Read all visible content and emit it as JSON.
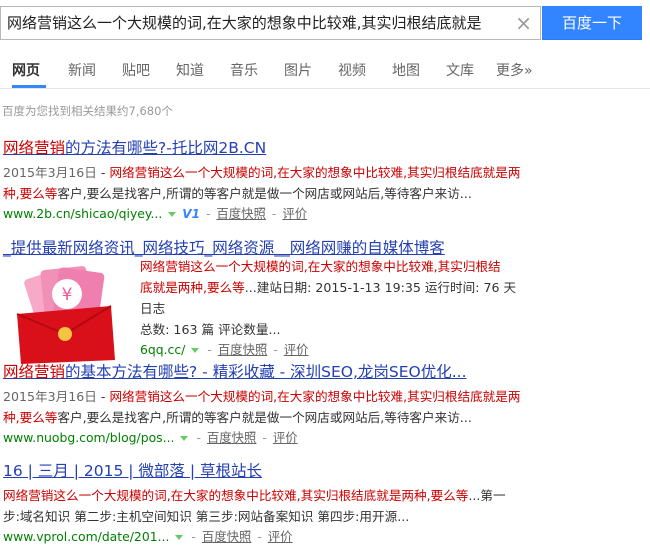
{
  "search": {
    "query": "网络营销这么一个大规模的词,在大家的想象中比较难,其实归根结底就是",
    "button_label": "百度一下"
  },
  "tabs": [
    "网页",
    "新闻",
    "贴吧",
    "知道",
    "音乐",
    "图片",
    "视频",
    "地图",
    "文库",
    "更多»"
  ],
  "result_count": "百度为您找到相关结果约7,680个",
  "results": [
    {
      "title_pre": "",
      "title_em": "网络营销",
      "title_post": "的方法有哪些?-托比网2B.CN",
      "date": "2015年3月16日",
      "snippet_line1_em": "网络营销这么一个大规模的词,在大家的想象中比较难,其实归根结底就是两",
      "snippet_line2_em": "种,要么等",
      "snippet_line2_post": "客户,要么是找客户,所谓的等客户就是做一个网店或网站后,等待客户来访...",
      "url": "www.2b.cn/shicao/qiyey...",
      "badge": "V1",
      "cache": "百度快照",
      "rate": "评价"
    },
    {
      "title": "_提供最新网络资讯_网络技巧_网络资源__网络网赚的自媒体博客",
      "snippet_line1_em": "网络营销这么一个大规模的词,在大家的想象中比较难,其实归根结",
      "snippet_line2_em": "底就是两种,要么等",
      "snippet_line2_post": "...建站日期: 2015-1-13 19:35 运行时间: 76 天 日志",
      "snippet_line3": "总数: 163 篇 评论数量...",
      "url": "6qq.cc/",
      "cache": "百度快照",
      "rate": "评价"
    },
    {
      "title_em": "网络营销",
      "title_post": "的基本方法有哪些? - 精彩收藏 - 深圳SEO,龙岗SEO优化...",
      "date": "2015年3月16日",
      "snippet_line1_em": "网络营销这么一个大规模的词,在大家的想象中比较难,其实归根结底就是两",
      "snippet_line2_em": "种,要么等",
      "snippet_line2_post": "客户,要么是找客户,所谓的等客户就是做一个网店或网站后,等待客户来访...",
      "url": "www.nuobg.com/blog/pos...",
      "cache": "百度快照",
      "rate": "评价"
    },
    {
      "title": "16 | 三月 | 2015 | 微部落 | 草根站长",
      "snippet_line1_em": "网络营销这么一个大规模的词,在大家的想象中比较难,其实归根结底就是两种,要么等",
      "snippet_line1_post": "...第一",
      "snippet_line2": "步:域名知识 第二步:主机空间知识 第三步:网站备案知识 第四步:用开源...",
      "url": "www.vprol.com/date/201...",
      "cache": "百度快照",
      "rate": "评价"
    }
  ]
}
